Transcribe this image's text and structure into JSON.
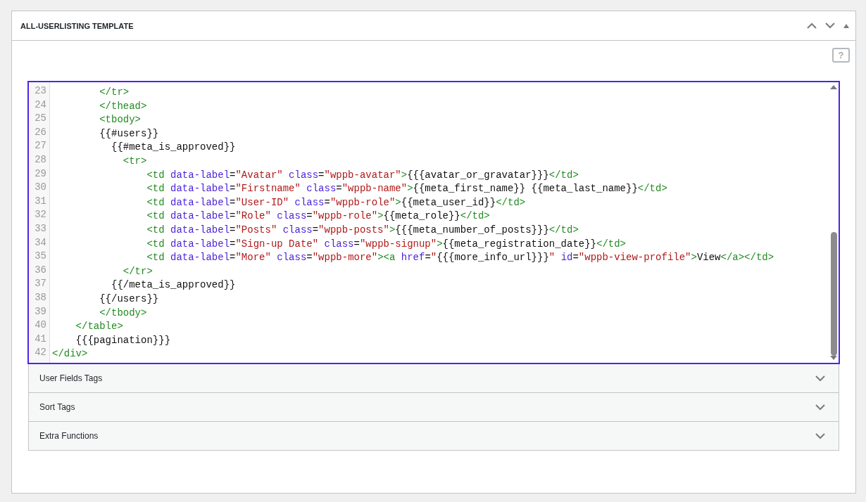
{
  "panel": {
    "title": "ALL-USERLISTING TEMPLATE",
    "help_icon": "?"
  },
  "editor": {
    "lines": [
      {
        "number": "23",
        "tokens": [
          {
            "kind": "tag",
            "text": "        </tr>"
          }
        ]
      },
      {
        "number": "24",
        "tokens": [
          {
            "kind": "tag",
            "text": "        </thead>"
          }
        ]
      },
      {
        "number": "25",
        "tokens": [
          {
            "kind": "tag",
            "text": "        <tbody>"
          }
        ]
      },
      {
        "number": "26",
        "tokens": [
          {
            "kind": "text",
            "text": "        {{#users}}"
          }
        ]
      },
      {
        "number": "27",
        "tokens": [
          {
            "kind": "text",
            "text": "          {{#meta_is_approved}}"
          }
        ]
      },
      {
        "number": "28",
        "tokens": [
          {
            "kind": "tag",
            "text": "            <tr>"
          }
        ]
      },
      {
        "number": "29",
        "tokens": [
          {
            "kind": "tag",
            "text": "                <td"
          },
          {
            "kind": "attr",
            "text": " data-label"
          },
          {
            "kind": "punct",
            "text": "="
          },
          {
            "kind": "string",
            "text": "\"Avatar\""
          },
          {
            "kind": "attr",
            "text": " class"
          },
          {
            "kind": "punct",
            "text": "="
          },
          {
            "kind": "string",
            "text": "\"wppb-avatar\""
          },
          {
            "kind": "tag",
            "text": ">"
          },
          {
            "kind": "text",
            "text": "{{{avatar_or_gravatar}}}"
          },
          {
            "kind": "tag",
            "text": "</td>"
          }
        ]
      },
      {
        "number": "30",
        "tokens": [
          {
            "kind": "tag",
            "text": "                <td"
          },
          {
            "kind": "attr",
            "text": " data-label"
          },
          {
            "kind": "punct",
            "text": "="
          },
          {
            "kind": "string",
            "text": "\"Firstname\""
          },
          {
            "kind": "attr",
            "text": " class"
          },
          {
            "kind": "punct",
            "text": "="
          },
          {
            "kind": "string",
            "text": "\"wppb-name\""
          },
          {
            "kind": "tag",
            "text": ">"
          },
          {
            "kind": "text",
            "text": "{{meta_first_name}} {{meta_last_name}}"
          },
          {
            "kind": "tag",
            "text": "</td>"
          }
        ]
      },
      {
        "number": "31",
        "tokens": [
          {
            "kind": "tag",
            "text": "                <td"
          },
          {
            "kind": "attr",
            "text": " data-label"
          },
          {
            "kind": "punct",
            "text": "="
          },
          {
            "kind": "string",
            "text": "\"User-ID\""
          },
          {
            "kind": "attr",
            "text": " class"
          },
          {
            "kind": "punct",
            "text": "="
          },
          {
            "kind": "string",
            "text": "\"wppb-role\""
          },
          {
            "kind": "tag",
            "text": ">"
          },
          {
            "kind": "text",
            "text": "{{meta_user_id}}"
          },
          {
            "kind": "tag",
            "text": "</td>"
          }
        ]
      },
      {
        "number": "32",
        "tokens": [
          {
            "kind": "tag",
            "text": "                <td"
          },
          {
            "kind": "attr",
            "text": " data-label"
          },
          {
            "kind": "punct",
            "text": "="
          },
          {
            "kind": "string",
            "text": "\"Role\""
          },
          {
            "kind": "attr",
            "text": " class"
          },
          {
            "kind": "punct",
            "text": "="
          },
          {
            "kind": "string",
            "text": "\"wppb-role\""
          },
          {
            "kind": "tag",
            "text": ">"
          },
          {
            "kind": "text",
            "text": "{{meta_role}}"
          },
          {
            "kind": "tag",
            "text": "</td>"
          }
        ]
      },
      {
        "number": "33",
        "tokens": [
          {
            "kind": "tag",
            "text": "                <td"
          },
          {
            "kind": "attr",
            "text": " data-label"
          },
          {
            "kind": "punct",
            "text": "="
          },
          {
            "kind": "string",
            "text": "\"Posts\""
          },
          {
            "kind": "attr",
            "text": " class"
          },
          {
            "kind": "punct",
            "text": "="
          },
          {
            "kind": "string",
            "text": "\"wppb-posts\""
          },
          {
            "kind": "tag",
            "text": ">"
          },
          {
            "kind": "text",
            "text": "{{{meta_number_of_posts}}}"
          },
          {
            "kind": "tag",
            "text": "</td>"
          }
        ]
      },
      {
        "number": "34",
        "tokens": [
          {
            "kind": "tag",
            "text": "                <td"
          },
          {
            "kind": "attr",
            "text": " data-label"
          },
          {
            "kind": "punct",
            "text": "="
          },
          {
            "kind": "string",
            "text": "\"Sign-up Date\""
          },
          {
            "kind": "attr",
            "text": " class"
          },
          {
            "kind": "punct",
            "text": "="
          },
          {
            "kind": "string",
            "text": "\"wppb-signup\""
          },
          {
            "kind": "tag",
            "text": ">"
          },
          {
            "kind": "text",
            "text": "{{meta_registration_date}}"
          },
          {
            "kind": "tag",
            "text": "</td>"
          }
        ]
      },
      {
        "number": "35",
        "tokens": [
          {
            "kind": "tag",
            "text": "                <td"
          },
          {
            "kind": "attr",
            "text": " data-label"
          },
          {
            "kind": "punct",
            "text": "="
          },
          {
            "kind": "string",
            "text": "\"More\""
          },
          {
            "kind": "attr",
            "text": " class"
          },
          {
            "kind": "punct",
            "text": "="
          },
          {
            "kind": "string",
            "text": "\"wppb-more\""
          },
          {
            "kind": "tag",
            "text": "><a"
          },
          {
            "kind": "attr",
            "text": " href"
          },
          {
            "kind": "punct",
            "text": "="
          },
          {
            "kind": "string",
            "text": "\""
          },
          {
            "kind": "text",
            "text": "{{{more_info_url}}}"
          },
          {
            "kind": "string",
            "text": "\""
          },
          {
            "kind": "attr",
            "text": " id"
          },
          {
            "kind": "punct",
            "text": "="
          },
          {
            "kind": "string",
            "text": "\"wppb-view-profile\""
          },
          {
            "kind": "tag",
            "text": ">"
          },
          {
            "kind": "text",
            "text": "View"
          },
          {
            "kind": "tag",
            "text": "</a></td>"
          }
        ]
      },
      {
        "number": "36",
        "tokens": [
          {
            "kind": "tag",
            "text": "            </tr>"
          }
        ]
      },
      {
        "number": "37",
        "tokens": [
          {
            "kind": "text",
            "text": "          {{/meta_is_approved}}"
          }
        ]
      },
      {
        "number": "38",
        "tokens": [
          {
            "kind": "text",
            "text": "        {{/users}}"
          }
        ]
      },
      {
        "number": "39",
        "tokens": [
          {
            "kind": "tag",
            "text": "        </tbody>"
          }
        ]
      },
      {
        "number": "40",
        "tokens": [
          {
            "kind": "tag",
            "text": "    </table>"
          }
        ]
      },
      {
        "number": "41",
        "tokens": [
          {
            "kind": "text",
            "text": "    {{{pagination}}}"
          }
        ]
      },
      {
        "number": "42",
        "tokens": [
          {
            "kind": "tag",
            "text": "</div>"
          }
        ]
      }
    ]
  },
  "sections": [
    {
      "label": "User Fields Tags",
      "expanded": false
    },
    {
      "label": "Sort Tags",
      "expanded": false
    },
    {
      "label": "Extra Functions",
      "expanded": false
    }
  ]
}
